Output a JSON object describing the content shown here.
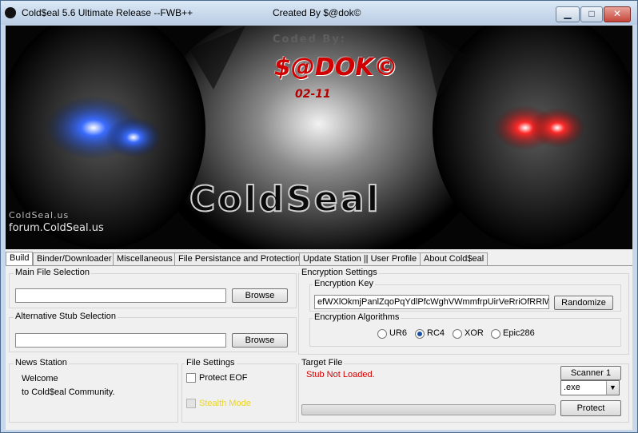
{
  "window": {
    "title": "Cold$eal 5.6 Ultimate Release --FWB++",
    "center_title": "Created By $@dok©",
    "minimize": "▁",
    "maximize": "□",
    "close": "✕"
  },
  "banner": {
    "coded_by": "Coded By:",
    "author": "$@DOK©",
    "date": "02-11",
    "logo": "ColdSeal",
    "site_line1": "ColdSeal.us",
    "site_line2": "forum.ColdSeal.us"
  },
  "tabs": [
    {
      "label": "Build"
    },
    {
      "label": "Binder/Downloader"
    },
    {
      "label": "Miscellaneous"
    },
    {
      "label": "File Persistance and Protection"
    },
    {
      "label": "Update Station || User Profile"
    },
    {
      "label": "About Cold$eal"
    }
  ],
  "build": {
    "main_file": {
      "label": "Main File Selection",
      "value": "",
      "browse": "Browse"
    },
    "alt_stub": {
      "label": "Alternative Stub Selection",
      "value": "",
      "browse": "Browse"
    },
    "encryption": {
      "label": "Encryption Settings",
      "key_label": "Encryption Key",
      "key_value": "efWXlOkmjPanlZqoPqYdlPfcWghVWmmfrpUirVeRriOfRRlWPW",
      "randomize": "Randomize",
      "algorithms_label": "Encryption Algorithms",
      "algorithms": [
        {
          "label": "UR6",
          "selected": false
        },
        {
          "label": "RC4",
          "selected": true
        },
        {
          "label": "XOR",
          "selected": false
        },
        {
          "label": "Epic286",
          "selected": false
        }
      ]
    },
    "news": {
      "label": "News Station",
      "line1": "Welcome",
      "line2": "to Cold$eal Community."
    },
    "file_settings": {
      "label": "File Settings",
      "protect_eof": "Protect EOF",
      "stealth_mode": "Stealth Mode"
    },
    "target": {
      "label": "Target File",
      "status": "Stub Not Loaded.",
      "status_color": "#d40000",
      "scanner": "Scanner 1",
      "extension": ".exe",
      "progress": 0,
      "protect": "Protect"
    }
  }
}
